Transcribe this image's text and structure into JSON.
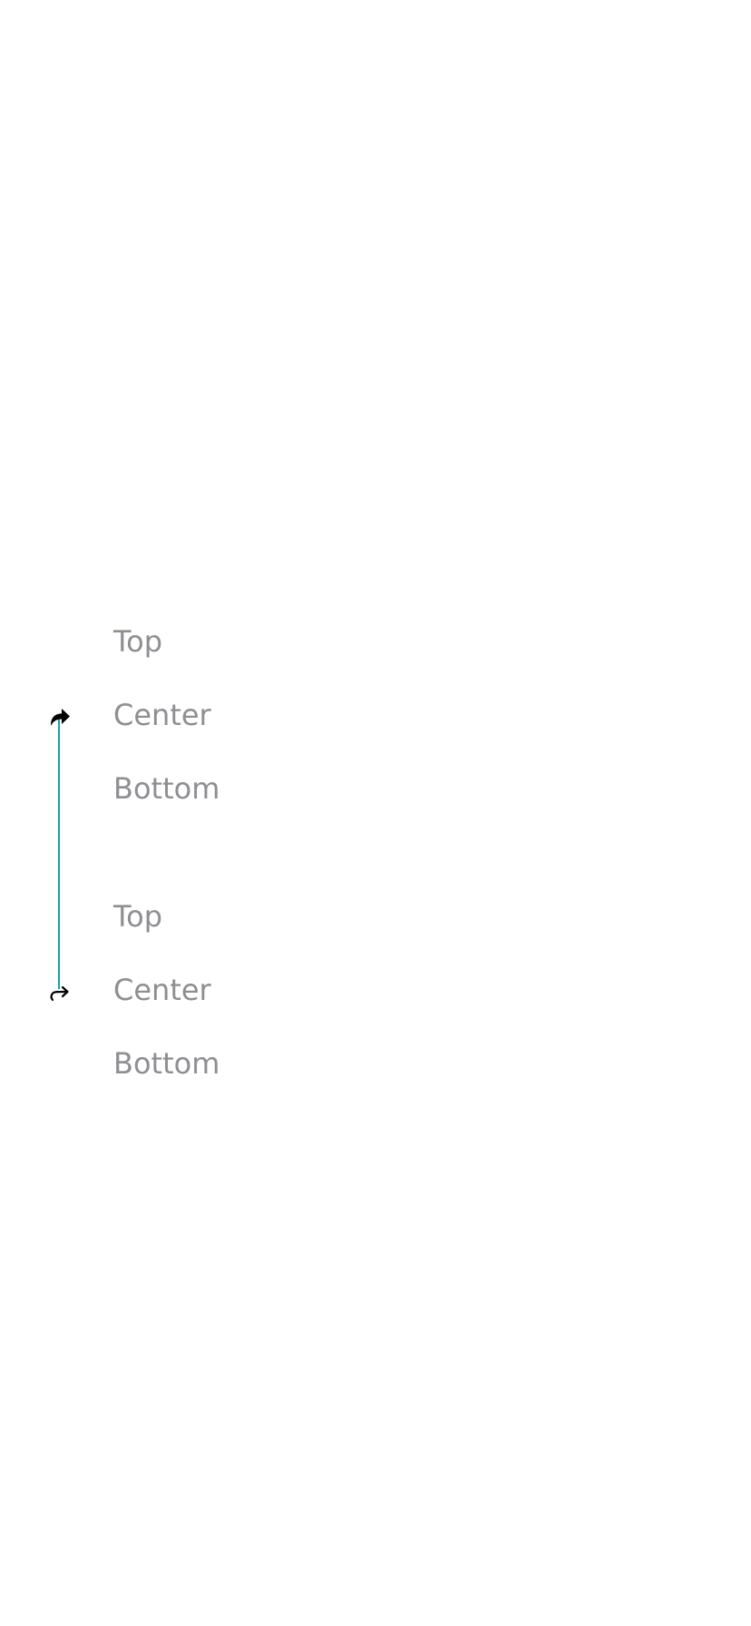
{
  "colors": {
    "accent": "#16a2a2",
    "label": "#8e8e93",
    "icon": "#000000",
    "background": "#ffffff"
  },
  "start_marker": {
    "icon": "share-arrow-filled-icon"
  },
  "end_marker": {
    "icon": "share-arrow-outline-icon"
  },
  "picker_1": {
    "options": [
      {
        "label": "Top"
      },
      {
        "label": "Center"
      },
      {
        "label": "Bottom"
      }
    ]
  },
  "picker_2": {
    "options": [
      {
        "label": "Top"
      },
      {
        "label": "Center"
      },
      {
        "label": "Bottom"
      }
    ]
  }
}
